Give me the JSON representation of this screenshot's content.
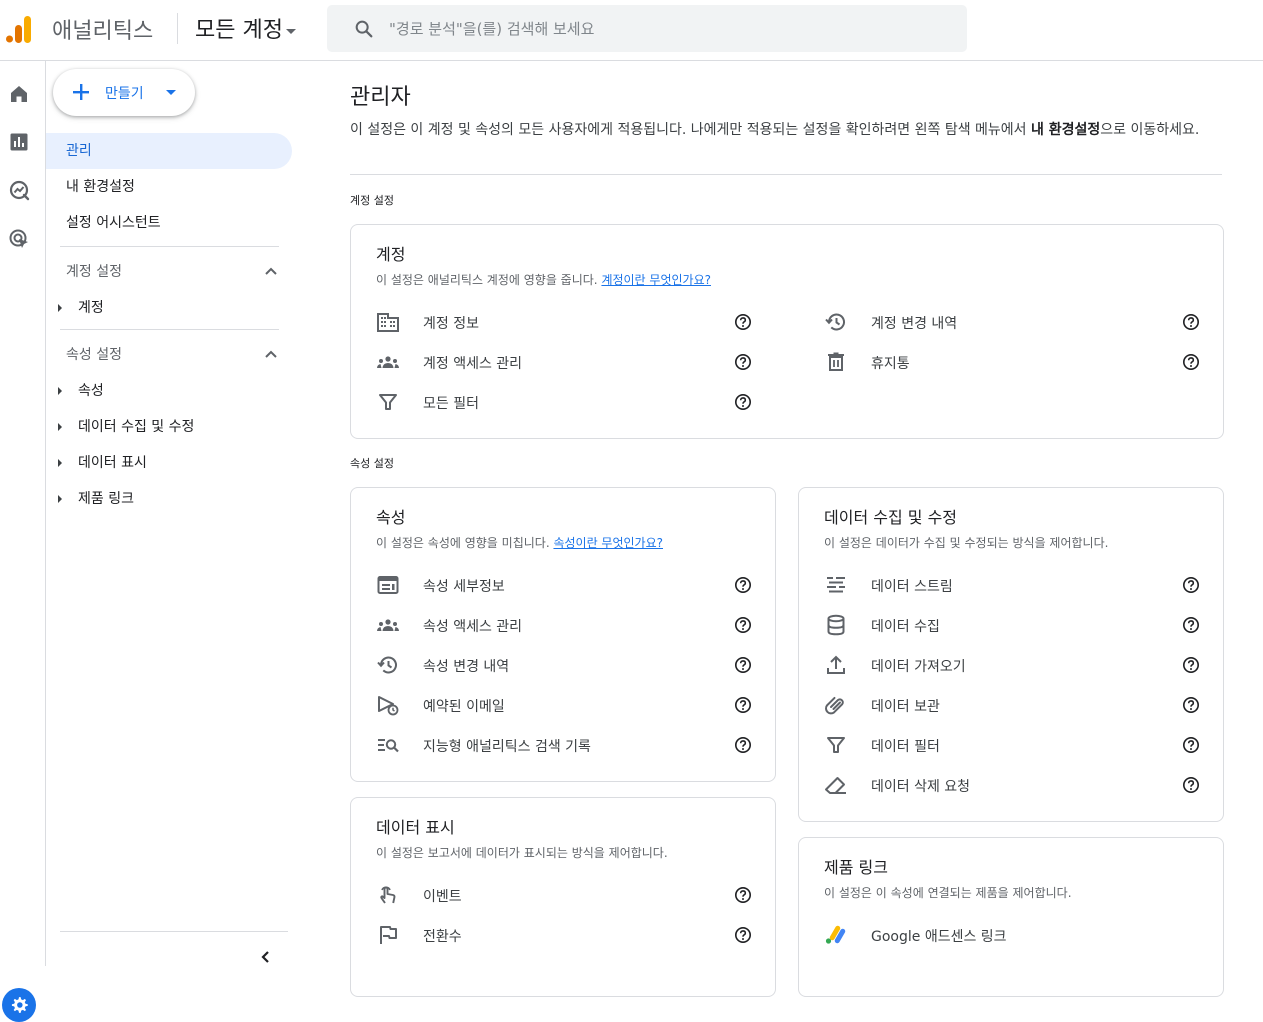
{
  "topbar": {
    "product_name": "애널리틱스",
    "account_selector": "모든 계정",
    "search_placeholder": "\"경로 분석\"을(를) 검색해 보세요"
  },
  "nav": {
    "create_label": "만들기",
    "items": [
      "관리",
      "내 환경설정",
      "설정 어시스턴트"
    ],
    "account_section": {
      "label": "계정 설정",
      "items": [
        "계정"
      ]
    },
    "property_section": {
      "label": "속성 설정",
      "items": [
        "속성",
        "데이터 수집 및 수정",
        "데이터 표시",
        "제품 링크"
      ]
    }
  },
  "main": {
    "title": "관리자",
    "desc_prefix": "이 설정은 이 계정 및 속성의 모든 사용자에게 적용됩니다. 나에게만 적용되는 설정을 확인하려면 왼쪽 탐색 메뉴에서 ",
    "desc_bold": "내 환경설정",
    "desc_suffix": "으로 이동하세요.",
    "account_heading": "계정 설정",
    "property_heading": "속성 설정",
    "cards": {
      "account": {
        "title": "계정",
        "desc": "이 설정은 애널리틱스 계정에 영향을 줍니다. ",
        "link": "계정이란 무엇인가요?",
        "left": [
          {
            "label": "계정 정보",
            "icon": "building-icon"
          },
          {
            "label": "계정 액세스 관리",
            "icon": "people-icon"
          },
          {
            "label": "모든 필터",
            "icon": "filter-icon"
          }
        ],
        "right": [
          {
            "label": "계정 변경 내역",
            "icon": "history-icon"
          },
          {
            "label": "휴지통",
            "icon": "trash-icon"
          }
        ]
      },
      "property": {
        "title": "속성",
        "desc": "이 설정은 속성에 영향을 미칩니다. ",
        "link": "속성이란 무엇인가요?",
        "items": [
          {
            "label": "속성 세부정보",
            "icon": "web-asset-icon"
          },
          {
            "label": "속성 액세스 관리",
            "icon": "people-icon"
          },
          {
            "label": "속성 변경 내역",
            "icon": "history-icon"
          },
          {
            "label": "예약된 이메일",
            "icon": "scheduled-email-icon"
          },
          {
            "label": "지능형 애널리틱스 검색 기록",
            "icon": "search-history-icon"
          }
        ]
      },
      "data_collection": {
        "title": "데이터 수집 및 수정",
        "desc": "이 설정은 데이터가 수집 및 수정되는 방식을 제어합니다.",
        "items": [
          {
            "label": "데이터 스트림",
            "icon": "stream-icon"
          },
          {
            "label": "데이터 수집",
            "icon": "database-icon"
          },
          {
            "label": "데이터 가져오기",
            "icon": "upload-icon"
          },
          {
            "label": "데이터 보관",
            "icon": "retention-icon"
          },
          {
            "label": "데이터 필터",
            "icon": "filter-icon"
          },
          {
            "label": "데이터 삭제 요청",
            "icon": "eraser-icon"
          }
        ]
      },
      "data_display": {
        "title": "데이터 표시",
        "desc": "이 설정은 보고서에 데이터가 표시되는 방식을 제어합니다.",
        "items": [
          {
            "label": "이벤트",
            "icon": "touch-icon"
          },
          {
            "label": "전환수",
            "icon": "flag-icon"
          }
        ]
      },
      "product_links": {
        "title": "제품 링크",
        "desc": "이 설정은 이 속성에 연결되는 제품을 제어합니다.",
        "items": [
          {
            "label": "Google 애드센스 링크",
            "icon": "adsense-logo-icon"
          }
        ]
      }
    }
  },
  "colors": {
    "accent": "#1a73e8",
    "nav_active_bg": "#e8f0fe",
    "logo_orange": "#f9ab00",
    "logo_dark_orange": "#e37400"
  }
}
